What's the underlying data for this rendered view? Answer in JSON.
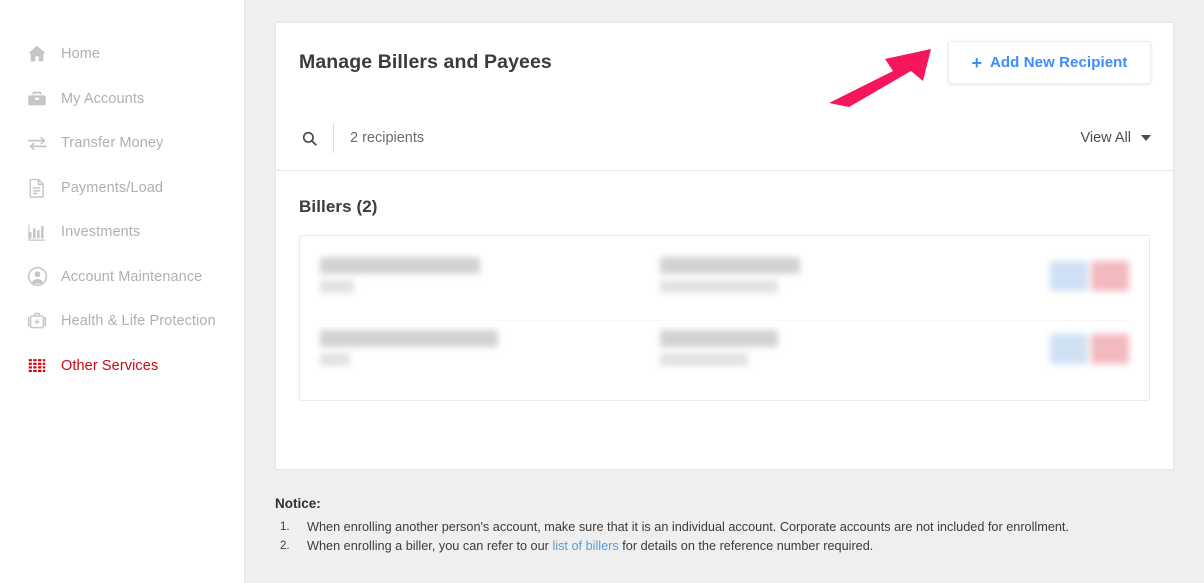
{
  "sidebar": {
    "items": [
      {
        "label": "Home",
        "icon": "home-icon",
        "active": false
      },
      {
        "label": "My Accounts",
        "icon": "briefcase-icon",
        "active": false
      },
      {
        "label": "Transfer Money",
        "icon": "transfer-arrows-icon",
        "active": false
      },
      {
        "label": "Payments/Load",
        "icon": "document-icon",
        "active": false
      },
      {
        "label": "Investments",
        "icon": "bar-chart-icon",
        "active": false
      },
      {
        "label": "Account Maintenance",
        "icon": "user-circle-icon",
        "active": false
      },
      {
        "label": "Health & Life Protection",
        "icon": "medical-kit-icon",
        "active": false
      },
      {
        "label": "Other Services",
        "icon": "list-menu-icon",
        "active": true
      }
    ]
  },
  "card": {
    "title": "Manage Billers and Payees",
    "add_button_label": "Add New Recipient",
    "add_button_plus": "+",
    "search": {
      "icon": "search-icon",
      "value": "",
      "placeholder": "2 recipients"
    },
    "view_all": {
      "label": "View All",
      "caret_icon": "chevron-down-icon"
    },
    "section_title": "Billers (2)",
    "rows": [
      {
        "name": "[redacted]",
        "name_sub": "[redacted]",
        "reference": "[redacted]",
        "reference_sub": "[redacted]",
        "actions": [
          {
            "name": "edit-button",
            "color": "#cfe0f5"
          },
          {
            "name": "delete-button",
            "color": "#f2b9bf"
          }
        ]
      },
      {
        "name": "[redacted]",
        "name_sub": "[redacted]",
        "reference": "[redacted]",
        "reference_sub": "[redacted]",
        "actions": [
          {
            "name": "edit-button",
            "color": "#cfe0f5"
          },
          {
            "name": "delete-button",
            "color": "#f2b9bf"
          }
        ]
      }
    ]
  },
  "notice": {
    "title": "Notice:",
    "items": [
      {
        "text_before": "When enrolling another person's account, make sure that it is an individual account. Corporate accounts are not included for enrollment.",
        "link": "",
        "text_after": ""
      },
      {
        "text_before": "When enrolling a biller, you can refer to our ",
        "link": "list of billers",
        "text_after": " for details on the reference number required."
      }
    ]
  },
  "annotation": {
    "arrow_color": "#F5165C",
    "arrow_target": "Add New Recipient"
  },
  "colors": {
    "brand_red": "#cc0711",
    "accent_blue": "#3d8bfd",
    "link_blue": "#5b9bd5",
    "page_bg": "#efefef"
  }
}
